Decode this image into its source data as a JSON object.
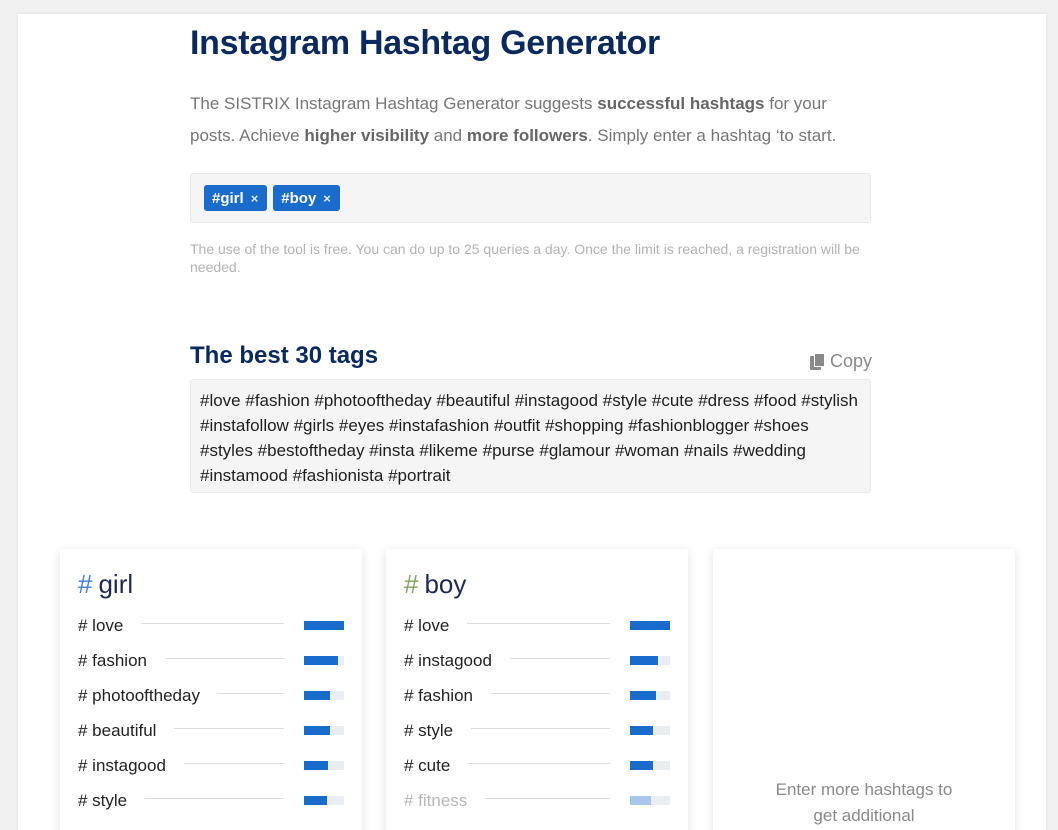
{
  "header": {
    "title": "Instagram Hashtag Generator",
    "intro": [
      {
        "t": "The SISTRIX Instagram Hashtag Generator suggests ",
        "b": false
      },
      {
        "t": "successful hashtags",
        "b": true
      },
      {
        "t": " for your posts. Achieve ",
        "b": false
      },
      {
        "t": "higher visibility",
        "b": true
      },
      {
        "t": " and ",
        "b": false
      },
      {
        "t": "more followers",
        "b": true
      },
      {
        "t": ". Simply enter a hashtag ‘to start.",
        "b": false
      }
    ]
  },
  "input": {
    "chips": [
      {
        "label": "#girl",
        "remove_icon": "×"
      },
      {
        "label": "#boy",
        "remove_icon": "×"
      }
    ]
  },
  "note": "The use of the tool is free. You can do up to 25 queries a day. Once the limit is reached, a registration will be needed.",
  "best": {
    "title": "The best 30 tags",
    "copy_label": "Copy",
    "copy_icon": "copy-icon",
    "tags": [
      "#love",
      "#fashion",
      "#photooftheday",
      "#beautiful",
      "#instagood",
      "#style",
      "#cute",
      "#dress",
      "#food",
      "#stylish",
      "#instafollow",
      "#girls",
      "#eyes",
      "#instafashion",
      "#outfit",
      "#shopping",
      "#fashionblogger",
      "#shoes",
      "#styles",
      "#bestoftheday",
      "#insta",
      "#likeme",
      "#purse",
      "#glamour",
      "#woman",
      "#nails",
      "#wedding",
      "#instamood",
      "#fashionista",
      "#portrait"
    ]
  },
  "cards": [
    {
      "hash": "#",
      "hash_color": "#3f7fd6",
      "name": "girl",
      "rows": [
        {
          "tag": "# love",
          "score": 1.0,
          "faded": false
        },
        {
          "tag": "# fashion",
          "score": 0.85,
          "faded": false
        },
        {
          "tag": "# photooftheday",
          "score": 0.65,
          "faded": false
        },
        {
          "tag": "# beautiful",
          "score": 0.65,
          "faded": false
        },
        {
          "tag": "# instagood",
          "score": 0.6,
          "faded": false
        },
        {
          "tag": "# style",
          "score": 0.58,
          "faded": false
        }
      ]
    },
    {
      "hash": "#",
      "hash_color": "#7fa35a",
      "name": "boy",
      "rows": [
        {
          "tag": "# love",
          "score": 1.0,
          "faded": false
        },
        {
          "tag": "# instagood",
          "score": 0.7,
          "faded": false
        },
        {
          "tag": "# fashion",
          "score": 0.65,
          "faded": false
        },
        {
          "tag": "# style",
          "score": 0.58,
          "faded": false
        },
        {
          "tag": "# cute",
          "score": 0.58,
          "faded": false
        },
        {
          "tag": "# fitness",
          "score": 0.52,
          "faded": true
        }
      ]
    }
  ],
  "placeholder_card": {
    "text_line1": "Enter more hashtags to",
    "text_line2": "get additional"
  },
  "colors": {
    "title": "#0a2a5e",
    "accent": "#1a6ccc",
    "muted": "#767676"
  }
}
